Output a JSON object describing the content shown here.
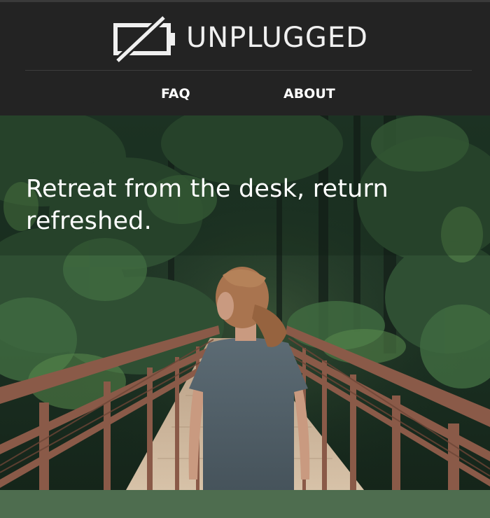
{
  "brand": {
    "name": "UNPLUGGED",
    "logo_icon": "crossed-out-battery-icon"
  },
  "nav": {
    "items": [
      {
        "label": "FAQ"
      },
      {
        "label": "ABOUT"
      }
    ]
  },
  "hero": {
    "headline": "Retreat from the desk, return refreshed.",
    "image": "woman-on-forest-bridge-photo"
  },
  "colors": {
    "header_bg": "#232323",
    "nav_text": "#ffffff",
    "hero_text": "#ffffff",
    "band_green": "#4e6d4f",
    "bridge_rust": "#8a5a48"
  }
}
